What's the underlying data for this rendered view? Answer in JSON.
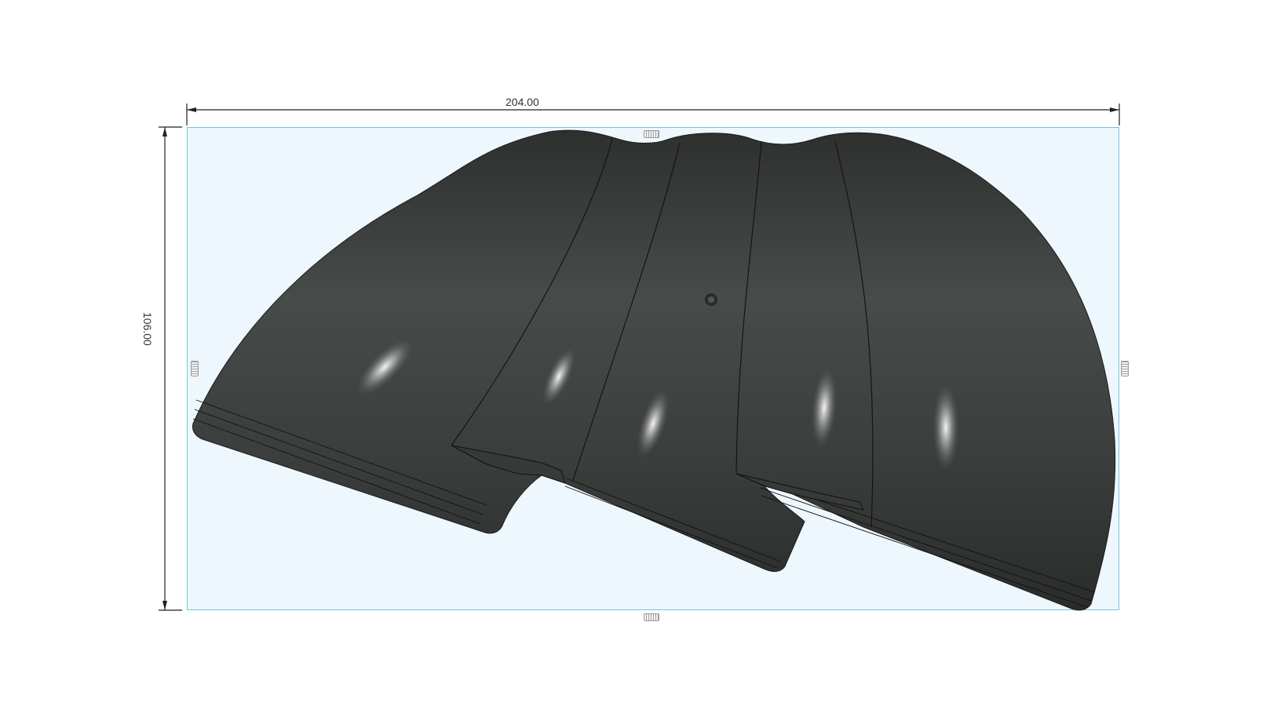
{
  "dimensions": {
    "width_value": "204.00",
    "height_value": "106.00"
  },
  "colors": {
    "selection_box_border": "#74c4e2",
    "selection_box_fill": "#eef7fd",
    "body_dark": "#2c2f2d",
    "body_mid": "#454947",
    "dimension_line": "#222222"
  },
  "model": {
    "type": "3d-body",
    "segments": 5
  },
  "handles": [
    "resize-handle-top",
    "resize-handle-bottom",
    "resize-handle-left",
    "resize-handle-right"
  ]
}
